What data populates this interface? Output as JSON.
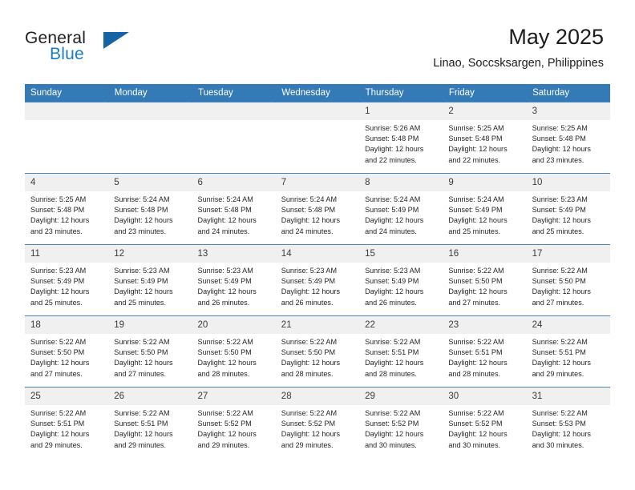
{
  "brand": {
    "name_top": "General",
    "name_bottom": "Blue",
    "accent_color": "#1a7cc4",
    "triangle_color": "#1464a5",
    "logo_icon": "triangle-logo-icon"
  },
  "header": {
    "title": "May 2025",
    "subtitle": "Linao, Soccsksargen, Philippines"
  },
  "calendar": {
    "header_bg": "#337ab7",
    "header_text_color": "#ffffff",
    "daynum_bg": "#f0f0f0",
    "weekdays": [
      "Sunday",
      "Monday",
      "Tuesday",
      "Wednesday",
      "Thursday",
      "Friday",
      "Saturday"
    ],
    "weeks": [
      [
        {
          "day": "",
          "empty": true,
          "lines": []
        },
        {
          "day": "",
          "empty": true,
          "lines": []
        },
        {
          "day": "",
          "empty": true,
          "lines": []
        },
        {
          "day": "",
          "empty": true,
          "lines": []
        },
        {
          "day": "1",
          "empty": false,
          "lines": [
            "Sunrise: 5:26 AM",
            "Sunset: 5:48 PM",
            "Daylight: 12 hours",
            "and 22 minutes."
          ]
        },
        {
          "day": "2",
          "empty": false,
          "lines": [
            "Sunrise: 5:25 AM",
            "Sunset: 5:48 PM",
            "Daylight: 12 hours",
            "and 22 minutes."
          ]
        },
        {
          "day": "3",
          "empty": false,
          "lines": [
            "Sunrise: 5:25 AM",
            "Sunset: 5:48 PM",
            "Daylight: 12 hours",
            "and 23 minutes."
          ]
        }
      ],
      [
        {
          "day": "4",
          "empty": false,
          "lines": [
            "Sunrise: 5:25 AM",
            "Sunset: 5:48 PM",
            "Daylight: 12 hours",
            "and 23 minutes."
          ]
        },
        {
          "day": "5",
          "empty": false,
          "lines": [
            "Sunrise: 5:24 AM",
            "Sunset: 5:48 PM",
            "Daylight: 12 hours",
            "and 23 minutes."
          ]
        },
        {
          "day": "6",
          "empty": false,
          "lines": [
            "Sunrise: 5:24 AM",
            "Sunset: 5:48 PM",
            "Daylight: 12 hours",
            "and 24 minutes."
          ]
        },
        {
          "day": "7",
          "empty": false,
          "lines": [
            "Sunrise: 5:24 AM",
            "Sunset: 5:48 PM",
            "Daylight: 12 hours",
            "and 24 minutes."
          ]
        },
        {
          "day": "8",
          "empty": false,
          "lines": [
            "Sunrise: 5:24 AM",
            "Sunset: 5:49 PM",
            "Daylight: 12 hours",
            "and 24 minutes."
          ]
        },
        {
          "day": "9",
          "empty": false,
          "lines": [
            "Sunrise: 5:24 AM",
            "Sunset: 5:49 PM",
            "Daylight: 12 hours",
            "and 25 minutes."
          ]
        },
        {
          "day": "10",
          "empty": false,
          "lines": [
            "Sunrise: 5:23 AM",
            "Sunset: 5:49 PM",
            "Daylight: 12 hours",
            "and 25 minutes."
          ]
        }
      ],
      [
        {
          "day": "11",
          "empty": false,
          "lines": [
            "Sunrise: 5:23 AM",
            "Sunset: 5:49 PM",
            "Daylight: 12 hours",
            "and 25 minutes."
          ]
        },
        {
          "day": "12",
          "empty": false,
          "lines": [
            "Sunrise: 5:23 AM",
            "Sunset: 5:49 PM",
            "Daylight: 12 hours",
            "and 25 minutes."
          ]
        },
        {
          "day": "13",
          "empty": false,
          "lines": [
            "Sunrise: 5:23 AM",
            "Sunset: 5:49 PM",
            "Daylight: 12 hours",
            "and 26 minutes."
          ]
        },
        {
          "day": "14",
          "empty": false,
          "lines": [
            "Sunrise: 5:23 AM",
            "Sunset: 5:49 PM",
            "Daylight: 12 hours",
            "and 26 minutes."
          ]
        },
        {
          "day": "15",
          "empty": false,
          "lines": [
            "Sunrise: 5:23 AM",
            "Sunset: 5:49 PM",
            "Daylight: 12 hours",
            "and 26 minutes."
          ]
        },
        {
          "day": "16",
          "empty": false,
          "lines": [
            "Sunrise: 5:22 AM",
            "Sunset: 5:50 PM",
            "Daylight: 12 hours",
            "and 27 minutes."
          ]
        },
        {
          "day": "17",
          "empty": false,
          "lines": [
            "Sunrise: 5:22 AM",
            "Sunset: 5:50 PM",
            "Daylight: 12 hours",
            "and 27 minutes."
          ]
        }
      ],
      [
        {
          "day": "18",
          "empty": false,
          "lines": [
            "Sunrise: 5:22 AM",
            "Sunset: 5:50 PM",
            "Daylight: 12 hours",
            "and 27 minutes."
          ]
        },
        {
          "day": "19",
          "empty": false,
          "lines": [
            "Sunrise: 5:22 AM",
            "Sunset: 5:50 PM",
            "Daylight: 12 hours",
            "and 27 minutes."
          ]
        },
        {
          "day": "20",
          "empty": false,
          "lines": [
            "Sunrise: 5:22 AM",
            "Sunset: 5:50 PM",
            "Daylight: 12 hours",
            "and 28 minutes."
          ]
        },
        {
          "day": "21",
          "empty": false,
          "lines": [
            "Sunrise: 5:22 AM",
            "Sunset: 5:50 PM",
            "Daylight: 12 hours",
            "and 28 minutes."
          ]
        },
        {
          "day": "22",
          "empty": false,
          "lines": [
            "Sunrise: 5:22 AM",
            "Sunset: 5:51 PM",
            "Daylight: 12 hours",
            "and 28 minutes."
          ]
        },
        {
          "day": "23",
          "empty": false,
          "lines": [
            "Sunrise: 5:22 AM",
            "Sunset: 5:51 PM",
            "Daylight: 12 hours",
            "and 28 minutes."
          ]
        },
        {
          "day": "24",
          "empty": false,
          "lines": [
            "Sunrise: 5:22 AM",
            "Sunset: 5:51 PM",
            "Daylight: 12 hours",
            "and 29 minutes."
          ]
        }
      ],
      [
        {
          "day": "25",
          "empty": false,
          "lines": [
            "Sunrise: 5:22 AM",
            "Sunset: 5:51 PM",
            "Daylight: 12 hours",
            "and 29 minutes."
          ]
        },
        {
          "day": "26",
          "empty": false,
          "lines": [
            "Sunrise: 5:22 AM",
            "Sunset: 5:51 PM",
            "Daylight: 12 hours",
            "and 29 minutes."
          ]
        },
        {
          "day": "27",
          "empty": false,
          "lines": [
            "Sunrise: 5:22 AM",
            "Sunset: 5:52 PM",
            "Daylight: 12 hours",
            "and 29 minutes."
          ]
        },
        {
          "day": "28",
          "empty": false,
          "lines": [
            "Sunrise: 5:22 AM",
            "Sunset: 5:52 PM",
            "Daylight: 12 hours",
            "and 29 minutes."
          ]
        },
        {
          "day": "29",
          "empty": false,
          "lines": [
            "Sunrise: 5:22 AM",
            "Sunset: 5:52 PM",
            "Daylight: 12 hours",
            "and 30 minutes."
          ]
        },
        {
          "day": "30",
          "empty": false,
          "lines": [
            "Sunrise: 5:22 AM",
            "Sunset: 5:52 PM",
            "Daylight: 12 hours",
            "and 30 minutes."
          ]
        },
        {
          "day": "31",
          "empty": false,
          "lines": [
            "Sunrise: 5:22 AM",
            "Sunset: 5:53 PM",
            "Daylight: 12 hours",
            "and 30 minutes."
          ]
        }
      ]
    ]
  }
}
